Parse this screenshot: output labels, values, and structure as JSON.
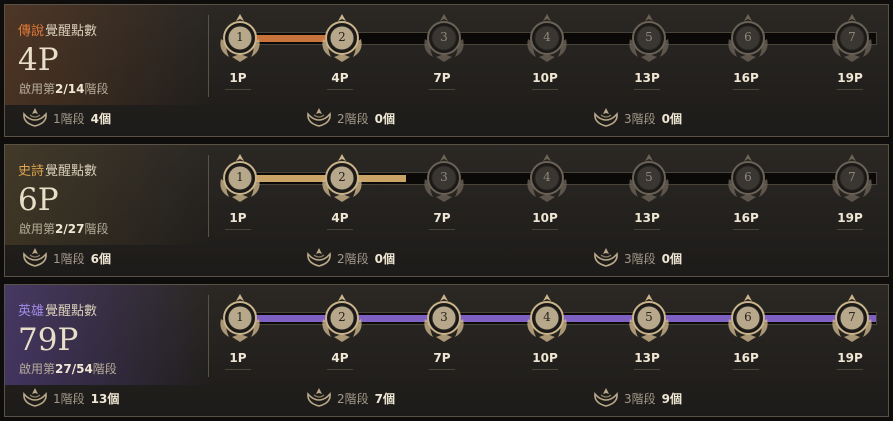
{
  "panels": [
    {
      "grade": "傳說",
      "grade_color": "#e07a3a",
      "title_suffix": "覺醒點數",
      "points": "4P",
      "usage_prefix": "啟用第",
      "usage_value": "2/14",
      "usage_suffix": "階段",
      "progress_color": "#c8733b",
      "progress_fraction": 0.163,
      "nodes_active": 2,
      "stages": [
        {
          "label": "1階段",
          "count": "4個"
        },
        {
          "label": "2階段",
          "count": "0個"
        },
        {
          "label": "3階段",
          "count": "0個"
        }
      ]
    },
    {
      "grade": "史詩",
      "grade_color": "#e0a54e",
      "title_suffix": "覺醒點數",
      "points": "6P",
      "usage_prefix": "啟用第",
      "usage_value": "2/27",
      "usage_suffix": "階段",
      "progress_color": "#c9a466",
      "progress_fraction": 0.265,
      "nodes_active": 2,
      "stages": [
        {
          "label": "1階段",
          "count": "6個"
        },
        {
          "label": "2階段",
          "count": "0個"
        },
        {
          "label": "3階段",
          "count": "0個"
        }
      ]
    },
    {
      "grade": "英雄",
      "grade_color": "#a08ce8",
      "title_suffix": "覺醒點數",
      "points": "79P",
      "usage_prefix": "啟用第",
      "usage_value": "27/54",
      "usage_suffix": "階段",
      "progress_color": "#7e5fc2",
      "progress_fraction": 1.0,
      "nodes_active": 7,
      "stages": [
        {
          "label": "1階段",
          "count": "13個"
        },
        {
          "label": "2階段",
          "count": "7個"
        },
        {
          "label": "3階段",
          "count": "9個"
        }
      ]
    }
  ],
  "nodes": [
    "1",
    "2",
    "3",
    "4",
    "5",
    "6",
    "7"
  ],
  "thresholds": [
    "1P",
    "4P",
    "7P",
    "10P",
    "13P",
    "16P",
    "19P"
  ],
  "icons": {
    "stage": "awakening-crest-icon",
    "node": "awakening-node-icon"
  }
}
